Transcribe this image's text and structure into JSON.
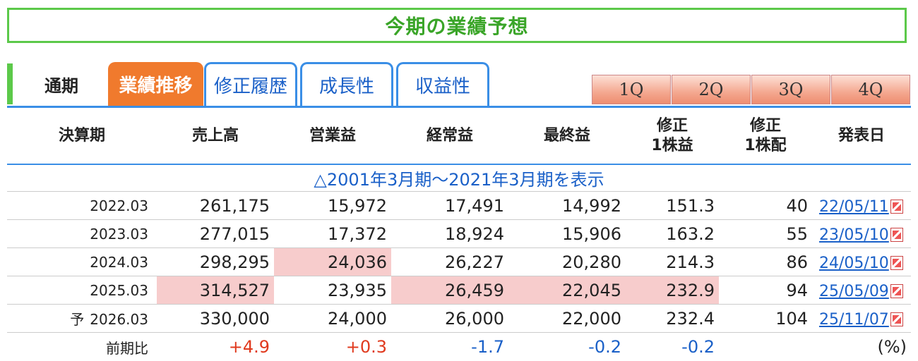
{
  "title": "今期の業績予想",
  "tabs": {
    "static": "通期",
    "items": [
      {
        "label": "業績推移",
        "active": true
      },
      {
        "label": "修正履歴",
        "active": false
      },
      {
        "label": "成長性",
        "active": false
      },
      {
        "label": "収益性",
        "active": false
      }
    ],
    "quarters": [
      "1Q",
      "2Q",
      "3Q",
      "4Q"
    ]
  },
  "table": {
    "headers": {
      "period": "決算期",
      "sales": "売上高",
      "op": "営業益",
      "ordinary": "経常益",
      "net": "最終益",
      "eps_l1": "修正",
      "eps_l2": "1株益",
      "div_l1": "修正",
      "div_l2": "1株配",
      "date": "発表日"
    },
    "expand_link": "△2001年3月期～2021年3月期を表示",
    "rows": [
      {
        "forecast_mark": "",
        "period": "2022.03",
        "sales": "261,175",
        "op": "15,972",
        "ordinary": "17,491",
        "net": "14,992",
        "eps": "151.3",
        "div": "40",
        "date": "22/05/11"
      },
      {
        "forecast_mark": "",
        "period": "2023.03",
        "sales": "277,015",
        "op": "17,372",
        "ordinary": "18,924",
        "net": "15,906",
        "eps": "163.2",
        "div": "55",
        "date": "23/05/10"
      },
      {
        "forecast_mark": "",
        "period": "2024.03",
        "sales": "298,295",
        "op": "24,036",
        "ordinary": "26,227",
        "net": "20,280",
        "eps": "214.3",
        "div": "86",
        "date": "24/05/10"
      },
      {
        "forecast_mark": "",
        "period": "2025.03",
        "sales": "314,527",
        "op": "23,935",
        "ordinary": "26,459",
        "net": "22,045",
        "eps": "232.9",
        "div": "94",
        "date": "25/05/09"
      },
      {
        "forecast_mark": "予",
        "period": "2026.03",
        "sales": "330,000",
        "op": "24,000",
        "ordinary": "26,000",
        "net": "22,000",
        "eps": "232.4",
        "div": "104",
        "date": "25/11/07"
      }
    ],
    "ratio": {
      "label": "前期比",
      "sales": "+4.9",
      "op": "+0.3",
      "ordinary": "-1.7",
      "net": "-0.2",
      "eps": "-0.2",
      "unit": "(%)"
    }
  },
  "colors": {
    "title_green": "#3aa528",
    "active_tab": "#f07a2d",
    "link_blue": "#1a60c8",
    "highlight": "#f7cccc",
    "positive": "#e03a1e",
    "negative": "#1a60c8"
  }
}
